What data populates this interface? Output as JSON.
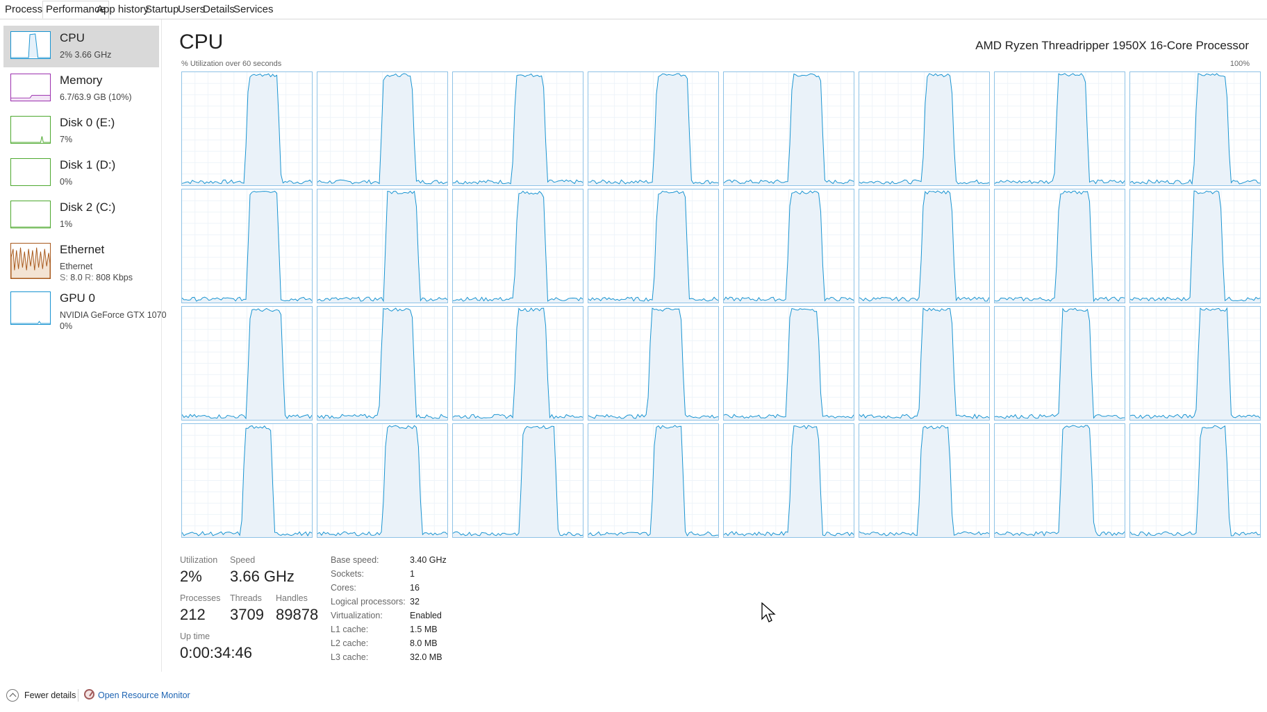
{
  "tabs": [
    {
      "label": "Processes",
      "active": false
    },
    {
      "label": "Performance",
      "active": true
    },
    {
      "label": "App history",
      "active": false
    },
    {
      "label": "Startup",
      "active": false
    },
    {
      "label": "Users",
      "active": false
    },
    {
      "label": "Details",
      "active": false
    },
    {
      "label": "Services",
      "active": false
    }
  ],
  "sidebar": {
    "items": [
      {
        "title": "CPU",
        "line1": "2%  3.66 GHz",
        "color": "#1793d1",
        "icon": "cpu-graph-icon"
      },
      {
        "title": "Memory",
        "line1": "6.7/63.9 GB (10%)",
        "color": "#9b2fae",
        "icon": "memory-graph-icon"
      },
      {
        "title": "Disk 0 (E:)",
        "line1": "7%",
        "color": "#4ca82d",
        "icon": "disk-graph-icon"
      },
      {
        "title": "Disk 1 (D:)",
        "line1": "0%",
        "color": "#4ca82d",
        "icon": "disk-graph-icon"
      },
      {
        "title": "Disk 2 (C:)",
        "line1": "1%",
        "color": "#4ca82d",
        "icon": "disk-graph-icon"
      },
      {
        "title": "Ethernet",
        "line1": "Ethernet",
        "line2_s_label": "S:",
        "line2_s_value": "8.0",
        "line2_r_label": "R:",
        "line2_r_value": "808 Kbps",
        "color": "#a7581b",
        "icon": "ethernet-graph-icon"
      },
      {
        "title": "GPU 0",
        "line1": "NVIDIA GeForce GTX 1070",
        "line2": "0%",
        "color": "#1793d1",
        "icon": "gpu-graph-icon"
      }
    ]
  },
  "main": {
    "title": "CPU",
    "processor_name": "AMD Ryzen Threadripper 1950X 16-Core Processor",
    "chart_caption": "% Utilization over 60 seconds",
    "chart_max": "100%",
    "logical_processor_graphs": 32,
    "graph_color": "#1793d1"
  },
  "stats": {
    "utilization_label": "Utilization",
    "utilization_value": "2%",
    "speed_label": "Speed",
    "speed_value": "3.66 GHz",
    "processes_label": "Processes",
    "processes_value": "212",
    "threads_label": "Threads",
    "threads_value": "3709",
    "handles_label": "Handles",
    "handles_value": "89878",
    "uptime_label": "Up time",
    "uptime_value": "0:00:34:46"
  },
  "specs": [
    {
      "label": "Base speed:",
      "value": "3.40 GHz"
    },
    {
      "label": "Sockets:",
      "value": "1"
    },
    {
      "label": "Cores:",
      "value": "16"
    },
    {
      "label": "Logical processors:",
      "value": "32"
    },
    {
      "label": "Virtualization:",
      "value": "Enabled"
    },
    {
      "label": "L1 cache:",
      "value": "1.5 MB"
    },
    {
      "label": "L2 cache:",
      "value": "8.0 MB"
    },
    {
      "label": "L3 cache:",
      "value": "32.0 MB"
    }
  ],
  "footer": {
    "fewer_details": "Fewer details",
    "open_resource_monitor": "Open Resource Monitor"
  }
}
